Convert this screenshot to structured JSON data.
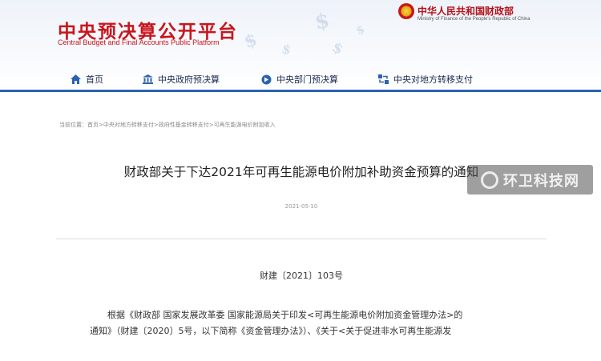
{
  "header": {
    "logo_title": "中央预决算公开平台",
    "logo_subtitle": "Central Budget and Final Accounts Public Platform",
    "ministry_cn": "中华人民共和国财政部",
    "ministry_en": "Ministry of Finance of the People's Republic of China",
    "brand_color": "#c8161d"
  },
  "nav": {
    "items": [
      {
        "label": "首页",
        "icon": "home-icon"
      },
      {
        "label": "中央政府预决算",
        "icon": "bank-icon"
      },
      {
        "label": "中央部门预决算",
        "icon": "globe-icon"
      },
      {
        "label": "中央对地方转移支付",
        "icon": "transfer-icon"
      }
    ],
    "accent_color": "#2b62b0"
  },
  "article": {
    "breadcrumb": "当前位置：首页>中央对地方转移支付>政府性基金转移支付>可再生能源电价附加收入",
    "title": "财政部关于下达2021年可再生能源电价附加补助资金预算的通知",
    "date": "2021-05-10",
    "doc_number": "财建〔2021〕103号",
    "body_lines": [
      "根据《财政部 国家发展改革委 国家能源局关于印发<可再生能源电价附加资金管理办法>的",
      "通知》（财建〔2020〕5号，以下简称《资金管理办法》）、《关于<关于促进非水可再生能源发"
    ]
  },
  "watermark": {
    "text": "环卫科技网"
  }
}
